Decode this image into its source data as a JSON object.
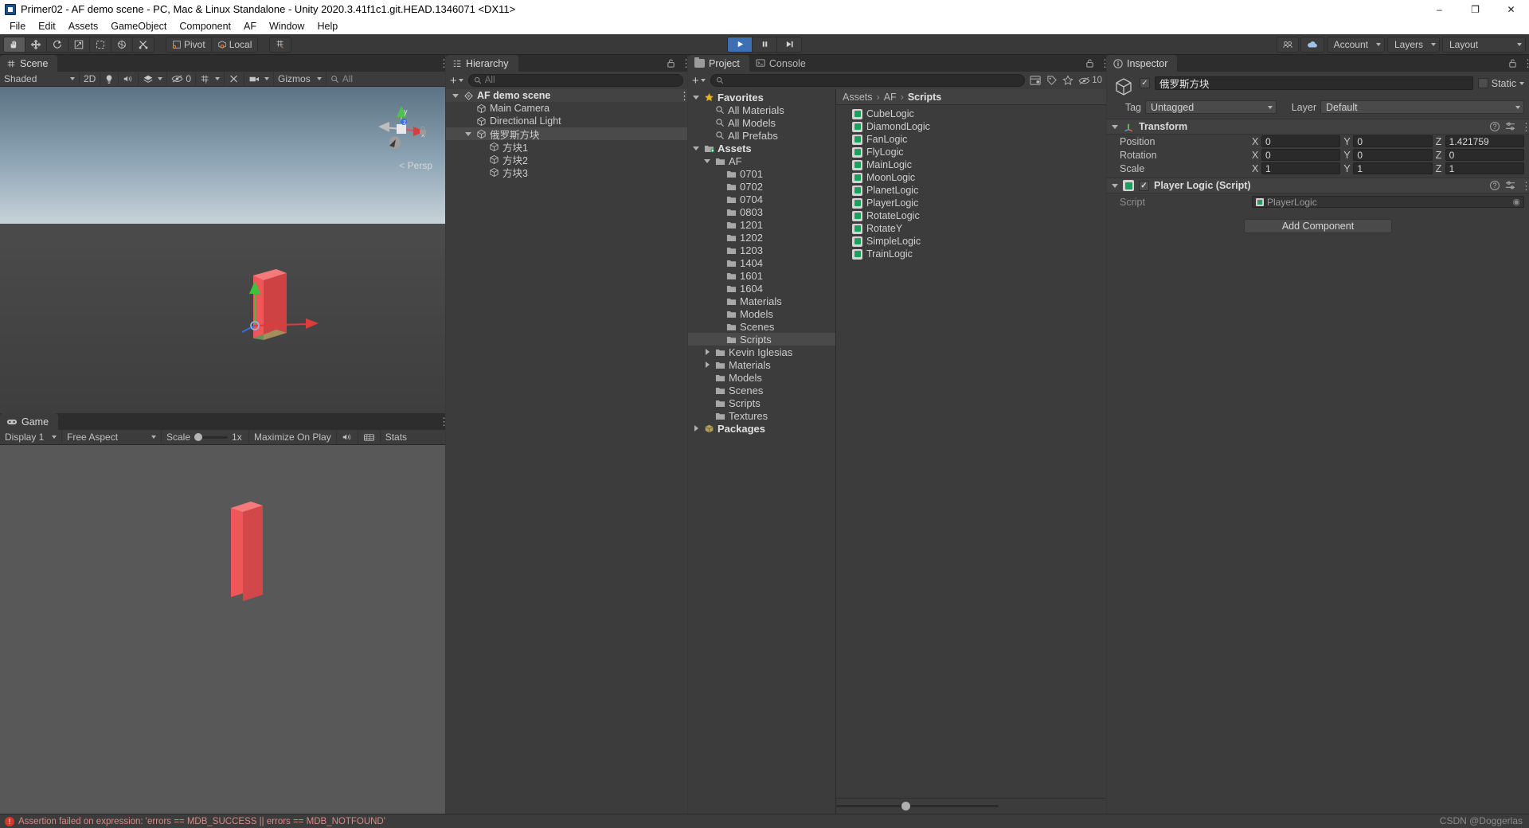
{
  "window": {
    "title": "Primer02 - AF demo scene - PC, Mac & Linux Standalone - Unity 2020.3.41f1c1.git.HEAD.1346071 <DX11>",
    "minimize": "–",
    "maximize": "❐",
    "close": "✕"
  },
  "menu": [
    "File",
    "Edit",
    "Assets",
    "GameObject",
    "Component",
    "AF",
    "Window",
    "Help"
  ],
  "toolbar": {
    "tools": [
      "hand-tool",
      "move-tool",
      "rotate-tool",
      "scale-tool",
      "rect-tool",
      "transform-tool",
      "custom-tool"
    ],
    "pivot_label": "Pivot",
    "local_label": "Local",
    "snap_label": "grid-snap",
    "play": "▶",
    "pause": "‖",
    "step": "▶|",
    "collab": "collab-icon",
    "cloud": "cloud-icon",
    "account_label": "Account",
    "layers_label": "Layers",
    "layout_label": "Layout"
  },
  "scene": {
    "tab": "Scene",
    "shading": "Shaded",
    "mode_2d": "2D",
    "lighting": "lighting-icon",
    "audio": "audio-icon",
    "fx": "fx-icon",
    "visibility_count": "0",
    "grid": "grid-icon",
    "tools": "scene-tools-icon",
    "camera": "camera-icon",
    "gizmos": "Gizmos",
    "search_placeholder": "All",
    "persp_label": "Persp",
    "gizmo_axes": [
      "y",
      "z",
      "x"
    ]
  },
  "game": {
    "tab": "Game",
    "display": "Display 1",
    "aspect": "Free Aspect",
    "scale_label": "Scale",
    "scale_value": "1x",
    "maximize": "Maximize On Play",
    "mute": "mute-audio-icon",
    "gizmos": "gizmos-icon",
    "stats": "Stats"
  },
  "hierarchy": {
    "tab": "Hierarchy",
    "search_placeholder": "All",
    "items": [
      {
        "label": "AF demo scene",
        "depth": 0,
        "icon": "scene-icon",
        "expanded": true,
        "selected": false,
        "bold": true
      },
      {
        "label": "Main Camera",
        "depth": 1,
        "icon": "gameobject-icon",
        "expanded": null,
        "selected": false,
        "bold": false
      },
      {
        "label": "Directional Light",
        "depth": 1,
        "icon": "gameobject-icon",
        "expanded": null,
        "selected": false,
        "bold": false
      },
      {
        "label": "俄罗斯方块",
        "depth": 1,
        "icon": "gameobject-icon",
        "expanded": true,
        "selected": true,
        "bold": false
      },
      {
        "label": "方块1",
        "depth": 2,
        "icon": "gameobject-icon",
        "expanded": null,
        "selected": false,
        "bold": false
      },
      {
        "label": "方块2",
        "depth": 2,
        "icon": "gameobject-icon",
        "expanded": null,
        "selected": false,
        "bold": false
      },
      {
        "label": "方块3",
        "depth": 2,
        "icon": "gameobject-icon",
        "expanded": null,
        "selected": false,
        "bold": false
      }
    ]
  },
  "project": {
    "tab": "Project",
    "console_tab": "Console",
    "search_placeholder": "",
    "result_count": "10",
    "tree": [
      {
        "label": "Favorites",
        "depth": 0,
        "icon": "star-icon",
        "expanded": true,
        "selected": false,
        "bold": true
      },
      {
        "label": "All Materials",
        "depth": 1,
        "icon": "search-icon",
        "expanded": null,
        "selected": false,
        "bold": false
      },
      {
        "label": "All Models",
        "depth": 1,
        "icon": "search-icon",
        "expanded": null,
        "selected": false,
        "bold": false
      },
      {
        "label": "All Prefabs",
        "depth": 1,
        "icon": "search-icon",
        "expanded": null,
        "selected": false,
        "bold": false
      },
      {
        "label": "Assets",
        "depth": 0,
        "icon": "assets-folder-icon",
        "expanded": true,
        "selected": false,
        "bold": true
      },
      {
        "label": "AF",
        "depth": 1,
        "icon": "folder-icon",
        "expanded": true,
        "selected": false,
        "bold": false
      },
      {
        "label": "0701",
        "depth": 2,
        "icon": "folder-icon",
        "expanded": null,
        "selected": false,
        "bold": false
      },
      {
        "label": "0702",
        "depth": 2,
        "icon": "folder-icon",
        "expanded": null,
        "selected": false,
        "bold": false
      },
      {
        "label": "0704",
        "depth": 2,
        "icon": "folder-icon",
        "expanded": null,
        "selected": false,
        "bold": false
      },
      {
        "label": "0803",
        "depth": 2,
        "icon": "folder-icon",
        "expanded": null,
        "selected": false,
        "bold": false
      },
      {
        "label": "1201",
        "depth": 2,
        "icon": "folder-icon",
        "expanded": null,
        "selected": false,
        "bold": false
      },
      {
        "label": "1202",
        "depth": 2,
        "icon": "folder-icon",
        "expanded": null,
        "selected": false,
        "bold": false
      },
      {
        "label": "1203",
        "depth": 2,
        "icon": "folder-icon",
        "expanded": null,
        "selected": false,
        "bold": false
      },
      {
        "label": "1404",
        "depth": 2,
        "icon": "folder-icon",
        "expanded": null,
        "selected": false,
        "bold": false
      },
      {
        "label": "1601",
        "depth": 2,
        "icon": "folder-icon",
        "expanded": null,
        "selected": false,
        "bold": false
      },
      {
        "label": "1604",
        "depth": 2,
        "icon": "folder-icon",
        "expanded": null,
        "selected": false,
        "bold": false
      },
      {
        "label": "Materials",
        "depth": 2,
        "icon": "folder-icon",
        "expanded": null,
        "selected": false,
        "bold": false
      },
      {
        "label": "Models",
        "depth": 2,
        "icon": "folder-icon",
        "expanded": null,
        "selected": false,
        "bold": false
      },
      {
        "label": "Scenes",
        "depth": 2,
        "icon": "folder-icon",
        "expanded": null,
        "selected": false,
        "bold": false
      },
      {
        "label": "Scripts",
        "depth": 2,
        "icon": "folder-icon",
        "expanded": null,
        "selected": true,
        "bold": false
      },
      {
        "label": "Kevin Iglesias",
        "depth": 1,
        "icon": "folder-icon",
        "expanded": false,
        "selected": false,
        "bold": false
      },
      {
        "label": "Materials",
        "depth": 1,
        "icon": "folder-icon",
        "expanded": false,
        "selected": false,
        "bold": false
      },
      {
        "label": "Models",
        "depth": 1,
        "icon": "folder-icon",
        "expanded": null,
        "selected": false,
        "bold": false
      },
      {
        "label": "Scenes",
        "depth": 1,
        "icon": "folder-icon",
        "expanded": null,
        "selected": false,
        "bold": false
      },
      {
        "label": "Scripts",
        "depth": 1,
        "icon": "folder-icon",
        "expanded": null,
        "selected": false,
        "bold": false
      },
      {
        "label": "Textures",
        "depth": 1,
        "icon": "folder-icon",
        "expanded": null,
        "selected": false,
        "bold": false
      },
      {
        "label": "Packages",
        "depth": 0,
        "icon": "packages-icon",
        "expanded": false,
        "selected": false,
        "bold": true
      }
    ],
    "breadcrumb": [
      "Assets",
      "AF",
      "Scripts"
    ],
    "files": [
      "CubeLogic",
      "DiamondLogic",
      "FanLogic",
      "FlyLogic",
      "MainLogic",
      "MoonLogic",
      "PlanetLogic",
      "PlayerLogic",
      "RotateLogic",
      "RotateY",
      "SimpleLogic",
      "TrainLogic"
    ]
  },
  "inspector": {
    "tab": "Inspector",
    "object_name": "俄罗斯方块",
    "enabled": true,
    "static_label": "Static",
    "tag_label": "Tag",
    "tag_value": "Untagged",
    "layer_label": "Layer",
    "layer_value": "Default",
    "transform": {
      "title": "Transform",
      "rows": [
        {
          "label": "Position",
          "x": "0",
          "y": "0",
          "z": "1.421759"
        },
        {
          "label": "Rotation",
          "x": "0",
          "y": "0",
          "z": "0"
        },
        {
          "label": "Scale",
          "x": "1",
          "y": "1",
          "z": "1"
        }
      ],
      "axes": [
        "X",
        "Y",
        "Z"
      ]
    },
    "script_component": {
      "title": "Player Logic (Script)",
      "script_label": "Script",
      "script_value": "PlayerLogic"
    },
    "add_component": "Add Component"
  },
  "status": {
    "message": "Assertion failed on expression: 'errors == MDB_SUCCESS || errors == MDB_NOTFOUND'",
    "watermark": "CSDN @Doggerlas"
  },
  "colors": {
    "accent_blue": "#3c6fb4",
    "error_red": "#cf3a2b",
    "panel_bg": "#3c3c3c",
    "tab_bg": "#2d2d2d",
    "selection": "#4a4a4a",
    "cube_red": "#e8484a"
  }
}
